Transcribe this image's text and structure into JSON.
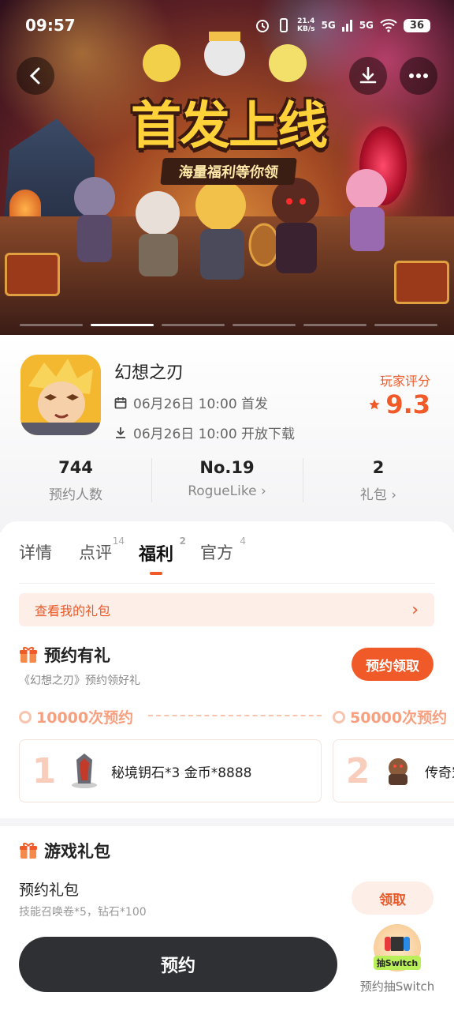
{
  "status_bar": {
    "time": "09:57",
    "net_speed_value": "21.4",
    "net_speed_unit": "KB/s",
    "signal1": "5G",
    "signal2": "5G",
    "battery": "36"
  },
  "banner": {
    "title": "首发上线",
    "subtitle": "海量福利等你领",
    "slide_count": 6,
    "active_slide": 2
  },
  "game": {
    "name": "幻想之刃",
    "release_line": "06月26日 10:00 首发",
    "download_line": "06月26日 10:00 开放下载",
    "rating_label": "玩家评分",
    "rating_value": "9.3"
  },
  "stats": [
    {
      "value": "744",
      "label": "预约人数"
    },
    {
      "value": "No.19",
      "label": "RogueLike",
      "chevron": "›"
    },
    {
      "value": "2",
      "label": "礼包",
      "chevron": "›"
    }
  ],
  "tabs": [
    {
      "label": "详情",
      "count": ""
    },
    {
      "label": "点评",
      "count": "14"
    },
    {
      "label": "福利",
      "count": "2"
    },
    {
      "label": "官方",
      "count": "4"
    }
  ],
  "my_gift_link": {
    "label": "查看我的礼包",
    "chevron": "›"
  },
  "reserve_reward": {
    "title": "预约有礼",
    "subtitle": "《幻想之刃》预约领好礼",
    "button": "预约领取",
    "milestones": [
      "10000次预约",
      "50000次预约"
    ],
    "rewards": [
      {
        "index": "1",
        "text": "秘境钥石*3 金币*8888"
      },
      {
        "index": "2",
        "text": "传奇宠"
      }
    ]
  },
  "game_gift": {
    "title": "游戏礼包",
    "pack_name": "预约礼包",
    "pack_desc": "技能召唤卷*5，钻石*100",
    "button": "领取"
  },
  "bottom": {
    "reserve_button": "预约",
    "lottery_badge": "抽Switch",
    "lottery_label": "预约抽Switch"
  },
  "colors": {
    "accent": "#f05a28",
    "dark_button": "#2f3033",
    "soft_accent": "#fdeee8"
  }
}
